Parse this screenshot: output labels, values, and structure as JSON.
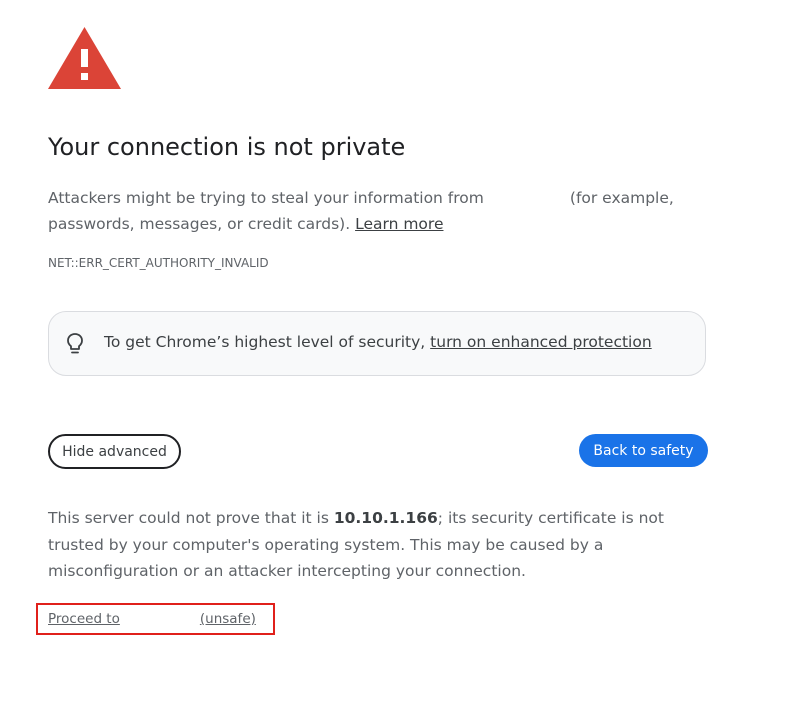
{
  "icons": {
    "warning": "warning-triangle-icon",
    "bulb": "lightbulb-icon"
  },
  "colors": {
    "warning_red": "#db4437",
    "primary_blue": "#1a73e8",
    "highlight_border": "#e0201b"
  },
  "title": "Your connection is not private",
  "main_message": {
    "part1": "Attackers might be trying to steal your information from",
    "part2": "(for example, passwords, messages, or credit cards).",
    "learn_more": "Learn more"
  },
  "error_code": "NET::ERR_CERT_AUTHORITY_INVALID",
  "enhanced_protection": {
    "text": "To get Chrome’s highest level of security,",
    "link": "turn on enhanced protection"
  },
  "buttons": {
    "hide_advanced": "Hide advanced",
    "back_to_safety": "Back to safety"
  },
  "details": {
    "part1": "This server could not prove that it is",
    "host": "10.10.1.166",
    "part2": "; its security certificate is not trusted by your computer's operating system. This may be caused by a misconfiguration or an attacker intercepting your connection."
  },
  "proceed": {
    "prefix": "Proceed to",
    "suffix": "(unsafe)"
  }
}
